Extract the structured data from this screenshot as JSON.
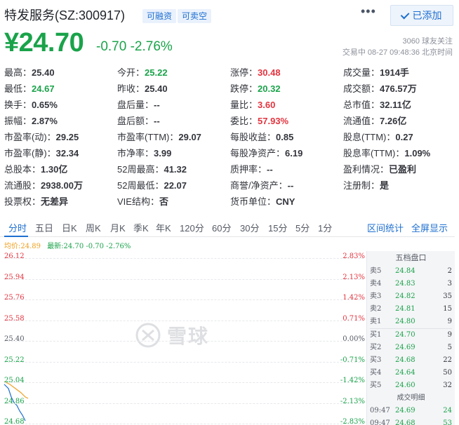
{
  "header": {
    "stock_name": "特发服务(SZ:300917)",
    "tags": [
      "可融资",
      "可卖空"
    ],
    "more_label": "•••",
    "follow_label": "已添加"
  },
  "price": {
    "current": "¥24.70",
    "change": "-0.70 -2.76%",
    "followers": "3060 球友关注",
    "trade_time": "交易中 08-27 09:48:36 北京时间"
  },
  "quote_rows": [
    [
      {
        "label": "最高：",
        "value": "25.40",
        "color": ""
      },
      {
        "label": "今开：",
        "value": "25.22",
        "color": "green"
      },
      {
        "label": "涨停：",
        "value": "30.48",
        "color": "red"
      },
      {
        "label": "成交量：",
        "value": "1914手",
        "color": ""
      }
    ],
    [
      {
        "label": "最低：",
        "value": "24.67",
        "color": "green"
      },
      {
        "label": "昨收：",
        "value": "25.40",
        "color": ""
      },
      {
        "label": "跌停：",
        "value": "20.32",
        "color": "green"
      },
      {
        "label": "成交额：",
        "value": "476.57万",
        "color": ""
      }
    ],
    [
      {
        "label": "换手：",
        "value": "0.65%",
        "color": ""
      },
      {
        "label": "盘后量：",
        "value": "--",
        "color": ""
      },
      {
        "label": "量比：",
        "value": "3.60",
        "color": "red"
      },
      {
        "label": "总市值：",
        "value": "32.11亿",
        "color": ""
      }
    ],
    [
      {
        "label": "振幅：",
        "value": "2.87%",
        "color": ""
      },
      {
        "label": "盘后额：",
        "value": "--",
        "color": ""
      },
      {
        "label": "委比：",
        "value": "57.93%",
        "color": "red"
      },
      {
        "label": "流通值：",
        "value": "7.26亿",
        "color": ""
      }
    ],
    [
      {
        "label": "市盈率(动)：",
        "value": "29.25",
        "color": ""
      },
      {
        "label": "市盈率(TTM)：",
        "value": "29.07",
        "color": ""
      },
      {
        "label": "每股收益：",
        "value": "0.85",
        "color": ""
      },
      {
        "label": "股息(TTM)：",
        "value": "0.27",
        "color": ""
      }
    ],
    [
      {
        "label": "市盈率(静)：",
        "value": "32.34",
        "color": ""
      },
      {
        "label": "市净率：",
        "value": "3.99",
        "color": ""
      },
      {
        "label": "每股净资产：",
        "value": "6.19",
        "color": ""
      },
      {
        "label": "股息率(TTM)：",
        "value": "1.09%",
        "color": ""
      }
    ],
    [
      {
        "label": "总股本：",
        "value": "1.30亿",
        "color": ""
      },
      {
        "label": "52周最高：",
        "value": "41.32",
        "color": ""
      },
      {
        "label": "质押率：",
        "value": "--",
        "color": ""
      },
      {
        "label": "盈利情况：",
        "value": "已盈利",
        "color": ""
      }
    ],
    [
      {
        "label": "流通股：",
        "value": "2938.00万",
        "color": ""
      },
      {
        "label": "52周最低：",
        "value": "22.07",
        "color": ""
      },
      {
        "label": "商誉/净资产：",
        "value": "--",
        "color": ""
      },
      {
        "label": "注册制：",
        "value": "是",
        "color": ""
      }
    ],
    [
      {
        "label": "投票权：",
        "value": "无差异",
        "color": ""
      },
      {
        "label": "VIE结构：",
        "value": "否",
        "color": ""
      },
      {
        "label": "货币单位：",
        "value": "CNY",
        "color": ""
      },
      {
        "label": "",
        "value": "",
        "color": ""
      }
    ]
  ],
  "tabs": [
    "分时",
    "五日",
    "日K",
    "周K",
    "月K",
    "季K",
    "年K",
    "120分",
    "60分",
    "30分",
    "15分",
    "5分",
    "1分"
  ],
  "tabs_right": [
    "区间统计",
    "全屏显示"
  ],
  "legend": {
    "avg": "均价:24.89",
    "latest": "最新:24.70 -0.70 -2.76%"
  },
  "chart_axis": {
    "left": [
      "26.12",
      "25.94",
      "25.76",
      "25.58",
      "25.40",
      "25.22",
      "25.04",
      "24.86",
      "24.68"
    ],
    "right": [
      "2.83%",
      "2.13%",
      "1.42%",
      "0.71%",
      "0.00%",
      "-0.71%",
      "-1.42%",
      "-2.13%",
      "-2.83%"
    ]
  },
  "watermark": "雪球",
  "orderbook": {
    "title": "五档盘口",
    "asks": [
      {
        "label": "卖5",
        "price": "24.84",
        "vol": "2"
      },
      {
        "label": "卖4",
        "price": "24.83",
        "vol": "3"
      },
      {
        "label": "卖3",
        "price": "24.82",
        "vol": "35"
      },
      {
        "label": "卖2",
        "price": "24.81",
        "vol": "15"
      },
      {
        "label": "卖1",
        "price": "24.80",
        "vol": "9"
      }
    ],
    "bids": [
      {
        "label": "买1",
        "price": "24.70",
        "vol": "9"
      },
      {
        "label": "买2",
        "price": "24.69",
        "vol": "5"
      },
      {
        "label": "买3",
        "price": "24.68",
        "vol": "22"
      },
      {
        "label": "买4",
        "price": "24.64",
        "vol": "50"
      },
      {
        "label": "买5",
        "price": "24.60",
        "vol": "32"
      }
    ],
    "trades_title": "成交明细",
    "trades": [
      {
        "time": "09:47",
        "price": "24.69",
        "vol": "24"
      },
      {
        "time": "09:47",
        "price": "24.68",
        "vol": "53"
      }
    ]
  },
  "colors": {
    "up": "#e3343f",
    "down": "#1aa34a",
    "accent": "#1e6fd0",
    "avg_line": "#f0a020"
  }
}
